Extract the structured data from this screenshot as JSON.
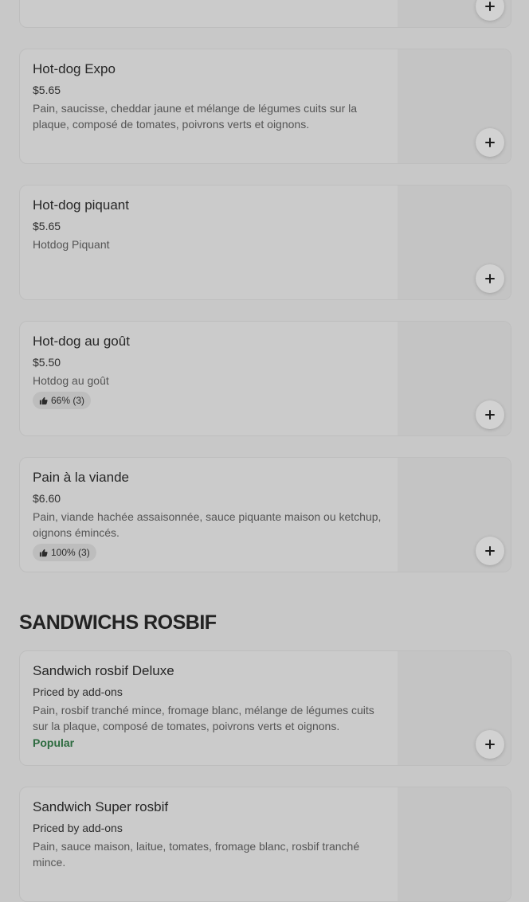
{
  "items_top": [
    {
      "title": "Hot-dog Expo",
      "price": "$5.65",
      "description": "Pain, saucisse, cheddar jaune et mélange de légumes cuits sur la plaque, composé de tomates, poivrons verts et oignons."
    },
    {
      "title": "Hot-dog piquant",
      "price": "$5.65",
      "description": "Hotdog Piquant"
    },
    {
      "title": "Hot-dog au goût",
      "price": "$5.50",
      "description": "Hotdog au goût",
      "rating": "66% (3)"
    },
    {
      "title": "Pain à la viande",
      "price": "$6.60",
      "description": "Pain, viande hachée assaisonnée, sauce piquante maison ou ketchup, oignons émincés.",
      "rating": "100% (3)"
    }
  ],
  "section": {
    "title": "SANDWICHS ROSBIF"
  },
  "items_section": [
    {
      "title": "Sandwich rosbif Deluxe",
      "price": "Priced by add-ons",
      "description": "Pain, rosbif tranché mince, fromage blanc, mélange de légumes cuits sur la plaque, composé de tomates, poivrons verts et oignons.",
      "tag": "Popular"
    },
    {
      "title": "Sandwich Super rosbif",
      "price": "Priced by add-ons",
      "description": "Pain, sauce maison, laitue, tomates, fromage blanc, rosbif tranché mince."
    }
  ],
  "icons": {
    "add": "plus-icon",
    "rating": "thumbs-up-icon"
  },
  "colors": {
    "popular": "#2c6b3f"
  }
}
